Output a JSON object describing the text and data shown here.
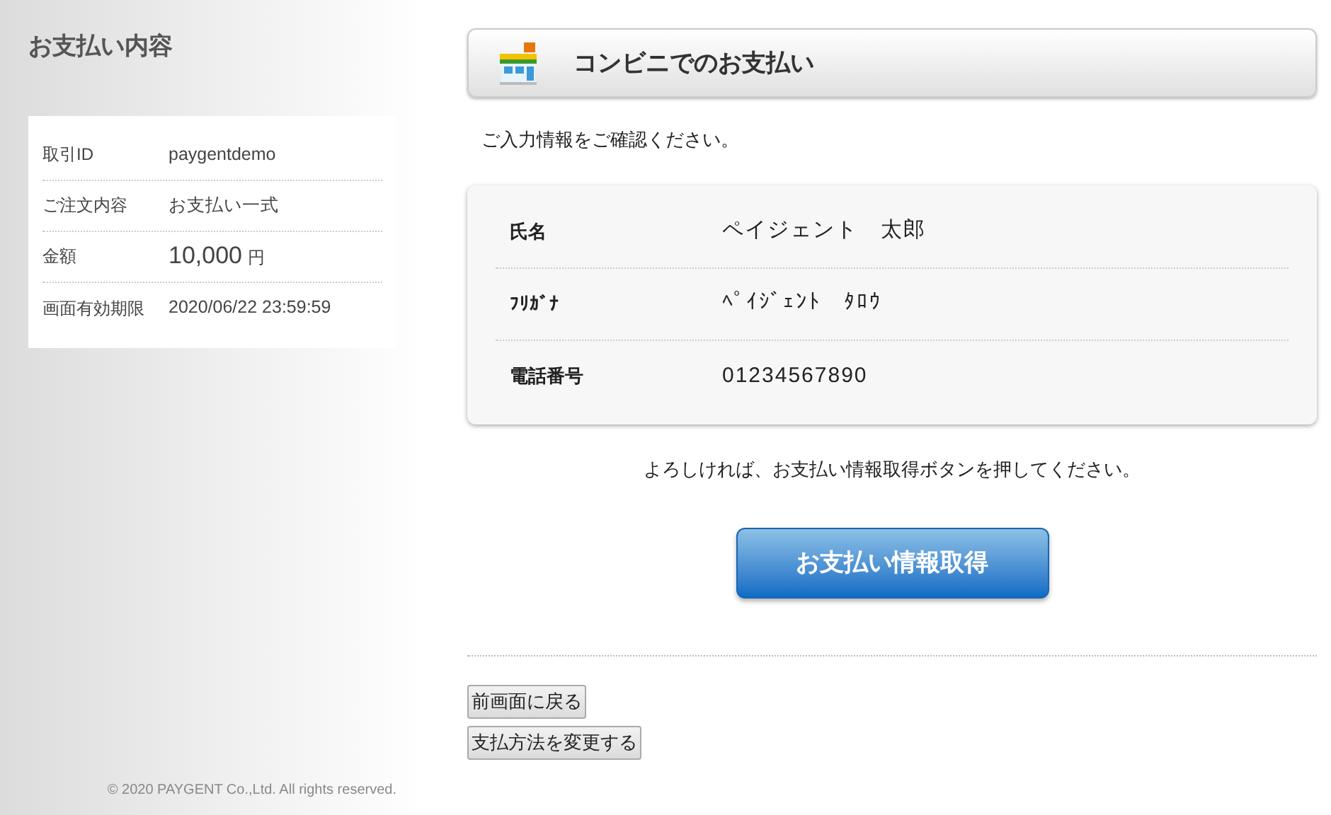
{
  "sidebar": {
    "title": "お支払い内容",
    "details": [
      {
        "label": "取引ID",
        "value": "paygentdemo"
      },
      {
        "label": "ご注文内容",
        "value": "お支払い一式"
      },
      {
        "label": "金額",
        "value": "10,000",
        "unit": "円",
        "kind": "amount"
      },
      {
        "label": "画面有効期限",
        "value": "2020/06/22 23:59:59"
      }
    ],
    "copyright": "© 2020 PAYGENT Co.,Ltd. All rights reserved."
  },
  "main": {
    "title": "コンビニでのお支払い",
    "intro": "ご入力情報をご確認ください。",
    "fields": [
      {
        "label": "氏名",
        "value": "ペイジェント　太郎"
      },
      {
        "label": "ﾌﾘｶﾞﾅ",
        "value": "ﾍﾟｲｼﾞｪﾝﾄ　ﾀﾛｳ"
      },
      {
        "label": "電話番号",
        "value": "01234567890"
      }
    ],
    "confirm_text": "よろしければ、お支払い情報取得ボタンを押してください。",
    "submit_button": "お支払い情報取得",
    "buttons": [
      "前画面に戻る",
      "支払方法を変更する"
    ]
  }
}
